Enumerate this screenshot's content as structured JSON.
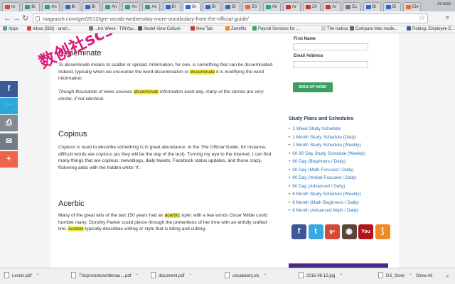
{
  "tabs": [
    {
      "label": "In",
      "color": "#d44"
    },
    {
      "label": "Bi",
      "color": "#2a7"
    },
    {
      "label": "An",
      "color": "#2a7"
    },
    {
      "label": "Bi",
      "color": "#36c"
    },
    {
      "label": "Bi",
      "color": "#36c"
    },
    {
      "label": "An",
      "color": "#2a7"
    },
    {
      "label": "An",
      "color": "#2a7"
    },
    {
      "label": "An",
      "color": "#2a7"
    },
    {
      "label": "Bi",
      "color": "#36c"
    },
    {
      "label": "Gr",
      "color": "#36c"
    },
    {
      "label": "Bi",
      "color": "#36c"
    },
    {
      "label": "Bi",
      "color": "#36c"
    },
    {
      "label": "Eli",
      "color": "#e63"
    },
    {
      "label": "An",
      "color": "#2a7"
    },
    {
      "label": "Ar",
      "color": "#c33"
    },
    {
      "label": "20",
      "color": "#c33"
    },
    {
      "label": "Ar",
      "color": "#c33"
    },
    {
      "label": "Ec",
      "color": "#777"
    },
    {
      "label": "Bi",
      "color": "#36c"
    },
    {
      "label": "Bi",
      "color": "#36c"
    },
    {
      "label": "Ele",
      "color": "#e63"
    }
  ],
  "window": {
    "user": "Ameda"
  },
  "toolbar": {
    "back": "←",
    "forward": "→",
    "reload": "↻",
    "url": "magoosh.com/gre/2012/gre-vocab-wednesday-more-vocabulary-from-the-official-guide/",
    "star": "☆",
    "menu": "≡"
  },
  "bookmarks": [
    {
      "label": "Apps",
      "color": "#5f9ea0"
    },
    {
      "label": "Inbox (583) - amrit...",
      "color": "#d44"
    },
    {
      "label": "...his Week - TINYpu...",
      "color": "#777"
    },
    {
      "label": "Model View Culture",
      "color": "#555"
    },
    {
      "label": "New Tab",
      "color": "#c33"
    },
    {
      "label": "Zenefits",
      "color": "#e83"
    },
    {
      "label": "Payroll Services for ...",
      "color": "#3a5"
    },
    {
      "label": "The Icebox",
      "color": "#ccc"
    },
    {
      "label": "Compare Mac mode...",
      "color": "#666"
    },
    {
      "label": "Reblog: Employee E...",
      "color": "#3b5998"
    }
  ],
  "watermark": {
    "text": "数创社scs66"
  },
  "share": [
    {
      "icon": "facebook-icon",
      "glyph": "f",
      "color": "#3b5998"
    },
    {
      "icon": "twitter-icon",
      "glyph": "🐦",
      "color": "#2ca8e0"
    },
    {
      "icon": "print-icon",
      "glyph": "⎙",
      "color": "#848c92"
    },
    {
      "icon": "email-icon",
      "glyph": "✉",
      "color": "#717b83"
    },
    {
      "icon": "more-icon",
      "glyph": "+",
      "color": "#f0654a"
    }
  ],
  "article": {
    "disseminate_heading": "Disseminate",
    "disseminate_p1_a": "To ",
    "disseminate_p1_em": "disseminate",
    "disseminate_p1_b": " means to scatter or spread. Information, for one, is something that can be disseminated. Indeed, typically when we encounter the word dissemination or ",
    "disseminate_p1_hl": "disseminate",
    "disseminate_p1_c": " it is modifying the word information.",
    "disseminate_p2_a": "Though thousands of news sources ",
    "disseminate_p2_hl": "disseminate",
    "disseminate_p2_b": " information each day, many of the stories are very similar, if not identical.",
    "copious_heading": "Copious",
    "copious_p1_em": "Copious",
    "copious_p1_a": " is used to describe something is in great abundance. In the ",
    "copious_p1_em2": "The Official Guide",
    "copious_p1_b": ", for instance, difficult words are ",
    "copious_p1_em3": "copious",
    "copious_p1_c": " (as they will be the day of the test). Turning my eye to the Internet, I can find many things that are ",
    "copious_p1_em4": "copious",
    "copious_p1_d": ": newsblogs, daily tweets, Facebook status updates, and those crazy, flickering adds with the hidden white 'X'.",
    "acerbic_heading": "Acerbic",
    "acerbic_p1_a": "Many of the great wits of the last 150 years had an ",
    "acerbic_p1_hl": "acerbic",
    "acerbic_p1_b": " style: with a few words Oscar Wilde could humble many; Dorothy Parker could pierce through the pretentions of her time with an artfully crafted line. ",
    "acerbic_p1_hl2": "Acerbic",
    "acerbic_p1_c": " typically describes writing or style that is biting and cutting."
  },
  "form": {
    "first_name_label": "First Name",
    "email_label": "Email Address",
    "signup_label": "SIGN UP NOW!"
  },
  "study": {
    "title": "Study Plans and Schedules",
    "items": [
      "1 Week Study Schedule",
      "1 Month Study Schedule (Daily)",
      "1 Month Study Schedule (Weekly)",
      "60-90 Day Study Schedule (Weekly)",
      "90 Day (Beginners / Daily)",
      "90 Day (Math Focused / Daily)",
      "90 Day (Verbal Focused / Daily)",
      "90 Day (Advanced / Daily)",
      "6 Month Study Schedule (Weekly)",
      "6 Month (Math Beginners / Daily)",
      "6 Month (Advanced Math / Daily)"
    ]
  },
  "social": [
    {
      "icon": "facebook-icon",
      "glyph": "f",
      "color": "#3b5998"
    },
    {
      "icon": "twitter-icon",
      "glyph": "t",
      "color": "#3aa9e0"
    },
    {
      "icon": "google-plus-icon",
      "glyph": "g+",
      "color": "#d34836"
    },
    {
      "icon": "instagram-icon",
      "glyph": "◉",
      "color": "#5b4438"
    },
    {
      "icon": "youtube-icon",
      "glyph": "You",
      "color": "#b31217"
    },
    {
      "icon": "rss-icon",
      "glyph": "⟆",
      "color": "#f08a24"
    }
  ],
  "downloads": {
    "items": [
      {
        "name": "Levels.pdf"
      },
      {
        "name": "Thisprovideswrittenau....pdf"
      },
      {
        "name": "document.pdf"
      },
      {
        "name": "vocabulary.xls"
      },
      {
        "name": "2016-08-12.jpg"
      },
      {
        "name": "DS_Store"
      }
    ],
    "show_all": "Show All",
    "close": "×"
  }
}
